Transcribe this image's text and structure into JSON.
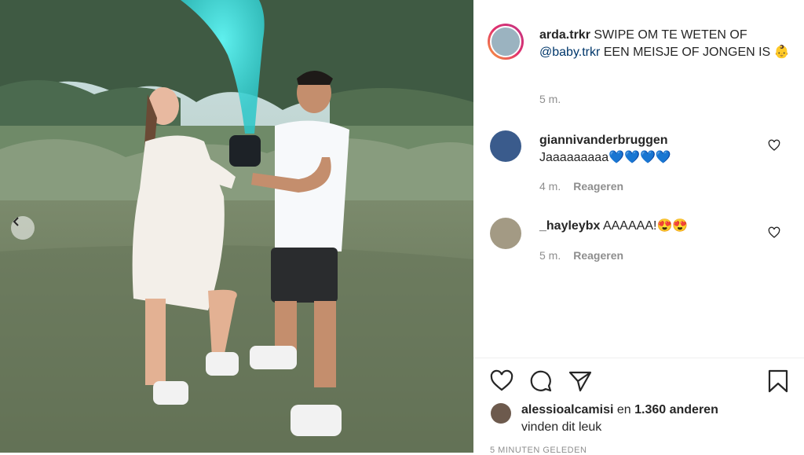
{
  "post": {
    "author": "arda.trkr",
    "caption_text": "SWIPE OM TE WETEN OF",
    "caption_mention": "@baby.trkr",
    "caption_rest": "EEN MEISJE OF JONGEN IS",
    "caption_emoji": "👶",
    "time": "5 m."
  },
  "comments": [
    {
      "user": "giannivanderbruggen",
      "text": "Jaaaaaaaaa",
      "emoji": "💙💙💙💙",
      "time": "4 m.",
      "reply": "Reageren"
    },
    {
      "user": "_hayleybx",
      "text": "AAAAAA!",
      "emoji": "😍😍",
      "time": "5 m.",
      "reply": "Reageren"
    }
  ],
  "likes": {
    "user": "alessioalcamisi",
    "connector": "en",
    "count": "1.360 anderen",
    "suffix": "vinden dit leuk"
  },
  "timestamp": "5 MINUTEN GELEDEN",
  "colors": {
    "smoke": "#3fd6d4",
    "mention": "#00376b",
    "meta": "#8e8e8e"
  },
  "icons": [
    "chevron-left-icon",
    "heart-icon",
    "comment-icon",
    "share-icon",
    "bookmark-icon"
  ]
}
